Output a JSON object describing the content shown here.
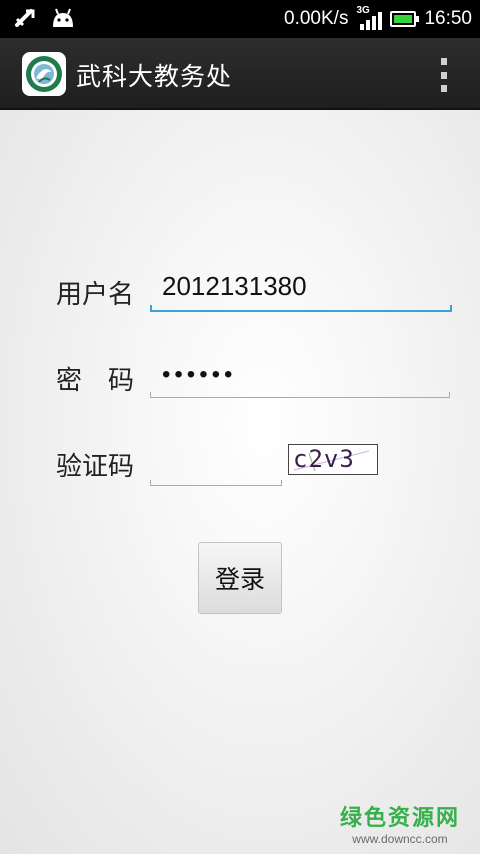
{
  "status_bar": {
    "network_speed": "0.00K/s",
    "network_type": "3G",
    "time": "16:50",
    "battery_color": "#35d43a"
  },
  "action_bar": {
    "title": "武科大教务处",
    "icon": "university-logo-icon",
    "menu_icon": "overflow-menu-icon"
  },
  "form": {
    "username_label": "用户名",
    "username_value": "2012131380",
    "password_label": "密　码",
    "password_value": "••••••",
    "captcha_label": "验证码",
    "captcha_value": "",
    "captcha_text": "c2v3",
    "login_label": "登录",
    "focus_color": "#3aa4d0"
  },
  "watermark": {
    "title": "绿色资源网",
    "url": "www.downcc.com"
  }
}
